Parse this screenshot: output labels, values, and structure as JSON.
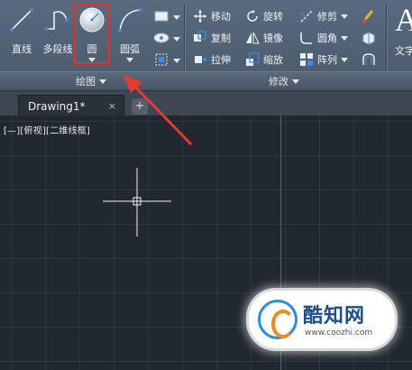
{
  "ribbon": {
    "draw_panel": {
      "title": "绘图",
      "buttons": [
        {
          "label": "直线",
          "icon": "line-icon"
        },
        {
          "label": "多段线",
          "icon": "polyline-icon"
        },
        {
          "label": "圆",
          "icon": "circle-icon"
        },
        {
          "label": "圆弧",
          "icon": "arc-icon"
        }
      ]
    },
    "modify_panel": {
      "title": "修改",
      "tools": [
        {
          "label": "移动",
          "icon": "move-icon"
        },
        {
          "label": "旋转",
          "icon": "rotate-icon"
        },
        {
          "label": "修剪",
          "icon": "trim-icon"
        },
        {
          "label": "复制",
          "icon": "copy-icon"
        },
        {
          "label": "镜像",
          "icon": "mirror-icon"
        },
        {
          "label": "圆角",
          "icon": "fillet-icon"
        },
        {
          "label": "拉伸",
          "icon": "stretch-icon"
        },
        {
          "label": "缩放",
          "icon": "scale-icon"
        },
        {
          "label": "阵列",
          "icon": "array-icon"
        }
      ]
    },
    "annotation_panel": {
      "label": "文字",
      "glyph": "A"
    }
  },
  "tabs": [
    {
      "label": "Drawing1*",
      "close": "×"
    }
  ],
  "tab_add": "+",
  "viewport": {
    "label": "[—][俯视][二维线框]"
  },
  "watermark": {
    "title": "酷知网",
    "url": "www.coozhi.com"
  },
  "colors": {
    "ribbon": "#56667a",
    "canvas": "#212830",
    "highlight": "#e03030",
    "ucs_y": "#2e7a3a"
  }
}
